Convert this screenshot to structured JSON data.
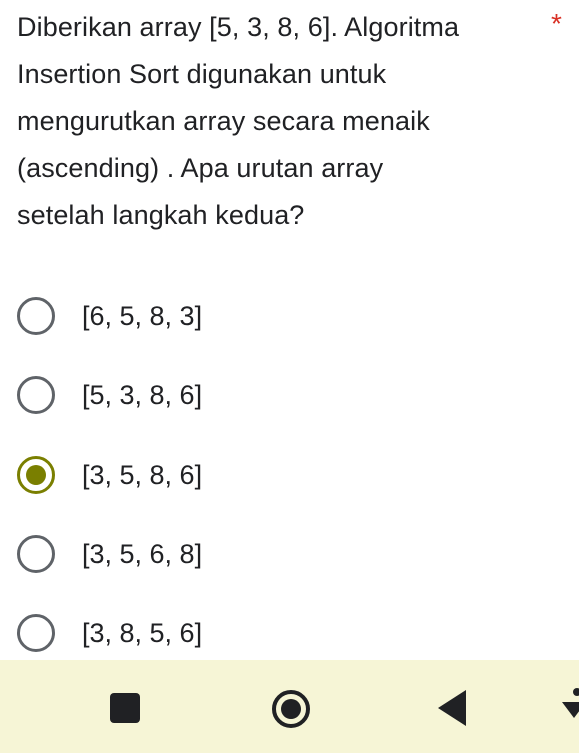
{
  "question": {
    "lines": [
      "Diberikan array [5, 3, 8, 6]. Algoritma",
      "Insertion Sort digunakan untuk",
      "mengurutkan array secara menaik",
      "(ascending) . Apa urutan array",
      "setelah langkah kedua?"
    ],
    "required_mark": "*"
  },
  "options": [
    {
      "label": "[6, 5, 8, 3]",
      "selected": false
    },
    {
      "label": "[5, 3, 8, 6]",
      "selected": false
    },
    {
      "label": "[3, 5, 8, 6]",
      "selected": true
    },
    {
      "label": "[3, 5, 6, 8]",
      "selected": false
    },
    {
      "label": "[3, 8, 5, 6]",
      "selected": false
    }
  ],
  "navbar": {
    "icons": [
      "recent-apps-icon",
      "home-icon",
      "back-icon",
      "accessibility-icon"
    ]
  },
  "colors": {
    "accent": "#7a7f00",
    "required": "#d93025",
    "navbar_bg": "#f6f5d6"
  }
}
